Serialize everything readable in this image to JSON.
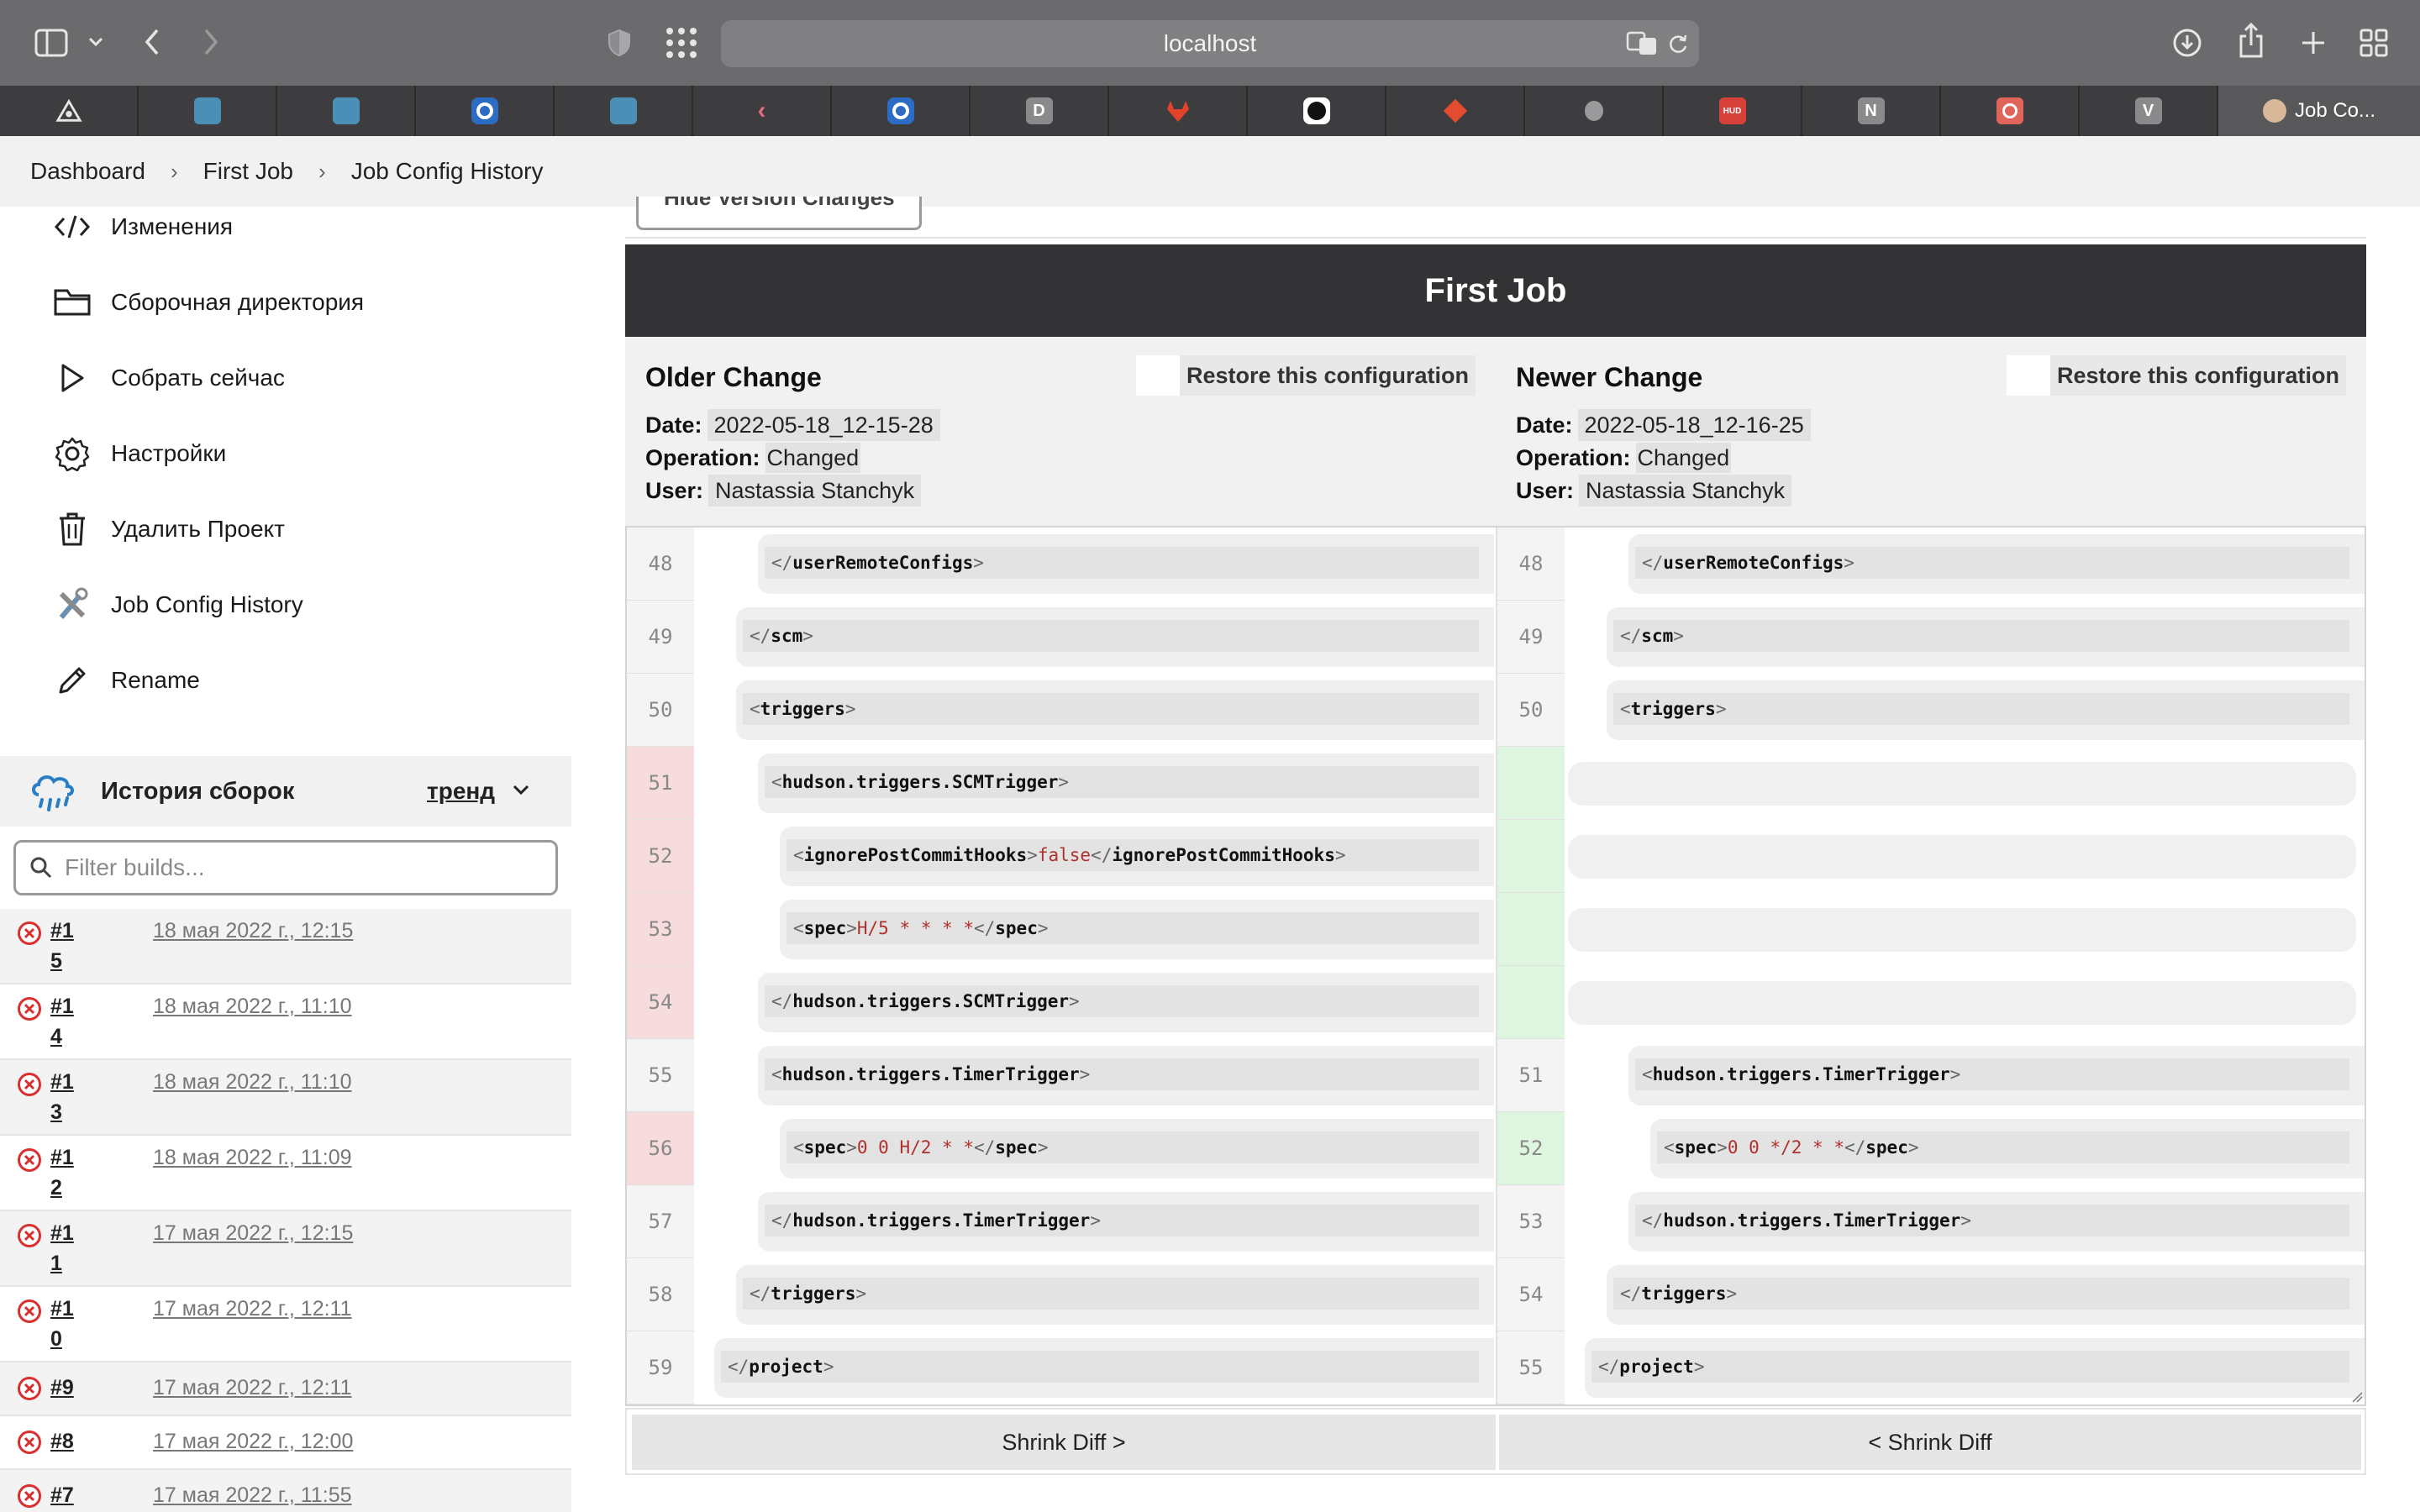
{
  "browser": {
    "url": "localhost",
    "active_tab_label": "Job Co...",
    "tabs": [
      {
        "icon": "app-icon",
        "label": ""
      },
      {
        "icon": "book-icon",
        "label": ""
      },
      {
        "icon": "book-icon",
        "label": ""
      },
      {
        "icon": "circle-icon",
        "label": ""
      },
      {
        "icon": "book-icon",
        "label": ""
      },
      {
        "icon": "flutter-icon",
        "label": ""
      },
      {
        "icon": "circle-icon",
        "label": ""
      },
      {
        "icon": "letter-icon",
        "label": "D"
      },
      {
        "icon": "gitlab-icon",
        "label": ""
      },
      {
        "icon": "github-icon",
        "label": ""
      },
      {
        "icon": "git-icon",
        "label": ""
      },
      {
        "icon": "apple-icon",
        "label": ""
      },
      {
        "icon": "hud-icon",
        "label": "HUD"
      },
      {
        "icon": "letter-icon",
        "label": "N"
      },
      {
        "icon": "openai-icon",
        "label": ""
      },
      {
        "icon": "letter-icon",
        "label": "V"
      }
    ]
  },
  "breadcrumb": [
    "Dashboard",
    "First Job",
    "Job Config History"
  ],
  "sidebar": {
    "tasks": [
      {
        "icon": "code-icon",
        "label": "Изменения"
      },
      {
        "icon": "folder-icon",
        "label": "Сборочная директория"
      },
      {
        "icon": "play-icon",
        "label": "Собрать сейчас"
      },
      {
        "icon": "gear-icon",
        "label": "Настройки"
      },
      {
        "icon": "trash-icon",
        "label": "Удалить Проект"
      },
      {
        "icon": "tools-icon",
        "label": "Job Config History"
      },
      {
        "icon": "pencil-icon",
        "label": "Rename"
      }
    ],
    "history_title": "История сборок",
    "trend_label": "тренд",
    "filter_placeholder": "Filter builds...",
    "builds": [
      {
        "num": "#15",
        "date": "18 мая 2022 г., 12:15"
      },
      {
        "num": "#14",
        "date": "18 мая 2022 г., 11:10"
      },
      {
        "num": "#13",
        "date": "18 мая 2022 г., 11:10"
      },
      {
        "num": "#12",
        "date": "18 мая 2022 г., 11:09"
      },
      {
        "num": "#11",
        "date": "17 мая 2022 г., 12:15"
      },
      {
        "num": "#10",
        "date": "17 мая 2022 г., 12:11"
      },
      {
        "num": "#9",
        "date": "17 мая 2022 г., 12:11"
      },
      {
        "num": "#8",
        "date": "17 мая 2022 г., 12:00"
      },
      {
        "num": "#7",
        "date": "17 мая 2022 г., 11:55"
      }
    ]
  },
  "main": {
    "hide_button_label": "Hide Version Changes",
    "job_title": "First Job",
    "older": {
      "heading": "Older Change",
      "restore_label": "Restore this configuration",
      "date_label": "Date:",
      "date": "2022-05-18_12-15-28",
      "operation_label": "Operation:",
      "operation": "Changed",
      "user_label": "User:",
      "user": "Nastassia Stanchyk"
    },
    "newer": {
      "heading": "Newer Change",
      "restore_label": "Restore this configuration",
      "date_label": "Date:",
      "date": "2022-05-18_12-16-25",
      "operation_label": "Operation:",
      "operation": "Changed",
      "user_label": "User:",
      "user": "Nastassia Stanchyk"
    },
    "diff_left": [
      {
        "n": "48",
        "state": "same",
        "indent": 2,
        "parts": [
          [
            "br",
            "</"
          ],
          [
            "tag",
            "userRemoteConfigs"
          ],
          [
            "br",
            ">"
          ]
        ]
      },
      {
        "n": "49",
        "state": "same",
        "indent": 1,
        "parts": [
          [
            "br",
            "</"
          ],
          [
            "tag",
            "scm"
          ],
          [
            "br",
            ">"
          ]
        ]
      },
      {
        "n": "50",
        "state": "same",
        "indent": 1,
        "parts": [
          [
            "br",
            "<"
          ],
          [
            "tag",
            "triggers"
          ],
          [
            "br",
            ">"
          ]
        ]
      },
      {
        "n": "51",
        "state": "del",
        "indent": 2,
        "parts": [
          [
            "br",
            "<"
          ],
          [
            "tag",
            "hudson.triggers.SCMTrigger"
          ],
          [
            "br",
            ">"
          ]
        ]
      },
      {
        "n": "52",
        "state": "del",
        "indent": 3,
        "parts": [
          [
            "br",
            "<"
          ],
          [
            "tag",
            "ignorePostCommitHooks"
          ],
          [
            "br",
            ">"
          ],
          [
            "txt",
            "false"
          ],
          [
            "br",
            "</"
          ],
          [
            "tag",
            "ignorePostCommitHooks"
          ],
          [
            "br",
            ">"
          ]
        ]
      },
      {
        "n": "53",
        "state": "del",
        "indent": 3,
        "parts": [
          [
            "br",
            "<"
          ],
          [
            "tag",
            "spec"
          ],
          [
            "br",
            ">"
          ],
          [
            "txt",
            "H/5 * * * *"
          ],
          [
            "br",
            "</"
          ],
          [
            "tag",
            "spec"
          ],
          [
            "br",
            ">"
          ]
        ]
      },
      {
        "n": "54",
        "state": "del",
        "indent": 2,
        "parts": [
          [
            "br",
            "</"
          ],
          [
            "tag",
            "hudson.triggers.SCMTrigger"
          ],
          [
            "br",
            ">"
          ]
        ]
      },
      {
        "n": "55",
        "state": "same",
        "indent": 2,
        "parts": [
          [
            "br",
            "<"
          ],
          [
            "tag",
            "hudson.triggers.TimerTrigger"
          ],
          [
            "br",
            ">"
          ]
        ]
      },
      {
        "n": "56",
        "state": "del",
        "indent": 3,
        "parts": [
          [
            "br",
            "<"
          ],
          [
            "tag",
            "spec"
          ],
          [
            "br",
            ">"
          ],
          [
            "txt",
            "0 0 H/2 * *"
          ],
          [
            "br",
            "</"
          ],
          [
            "tag",
            "spec"
          ],
          [
            "br",
            ">"
          ]
        ]
      },
      {
        "n": "57",
        "state": "same",
        "indent": 2,
        "parts": [
          [
            "br",
            "</"
          ],
          [
            "tag",
            "hudson.triggers.TimerTrigger"
          ],
          [
            "br",
            ">"
          ]
        ]
      },
      {
        "n": "58",
        "state": "same",
        "indent": 1,
        "parts": [
          [
            "br",
            "</"
          ],
          [
            "tag",
            "triggers"
          ],
          [
            "br",
            ">"
          ]
        ]
      },
      {
        "n": "59",
        "state": "same",
        "indent": 0,
        "parts": [
          [
            "br",
            "</"
          ],
          [
            "tag",
            "project"
          ],
          [
            "br",
            ">"
          ]
        ]
      }
    ],
    "diff_right": [
      {
        "n": "48",
        "state": "same",
        "indent": 2,
        "parts": [
          [
            "br",
            "</"
          ],
          [
            "tag",
            "userRemoteConfigs"
          ],
          [
            "br",
            ">"
          ]
        ]
      },
      {
        "n": "49",
        "state": "same",
        "indent": 1,
        "parts": [
          [
            "br",
            "</"
          ],
          [
            "tag",
            "scm"
          ],
          [
            "br",
            ">"
          ]
        ]
      },
      {
        "n": "50",
        "state": "same",
        "indent": 1,
        "parts": [
          [
            "br",
            "<"
          ],
          [
            "tag",
            "triggers"
          ],
          [
            "br",
            ">"
          ]
        ]
      },
      {
        "n": "",
        "state": "add-blank",
        "indent": 0,
        "parts": []
      },
      {
        "n": "",
        "state": "add-blank",
        "indent": 0,
        "parts": []
      },
      {
        "n": "",
        "state": "add-blank",
        "indent": 0,
        "parts": []
      },
      {
        "n": "",
        "state": "add-blank",
        "indent": 0,
        "parts": []
      },
      {
        "n": "51",
        "state": "same",
        "indent": 2,
        "parts": [
          [
            "br",
            "<"
          ],
          [
            "tag",
            "hudson.triggers.TimerTrigger"
          ],
          [
            "br",
            ">"
          ]
        ]
      },
      {
        "n": "52",
        "state": "add",
        "indent": 3,
        "parts": [
          [
            "br",
            "<"
          ],
          [
            "tag",
            "spec"
          ],
          [
            "br",
            ">"
          ],
          [
            "txt",
            "0 0 */2 * *"
          ],
          [
            "br",
            "</"
          ],
          [
            "tag",
            "spec"
          ],
          [
            "br",
            ">"
          ]
        ]
      },
      {
        "n": "53",
        "state": "same",
        "indent": 2,
        "parts": [
          [
            "br",
            "</"
          ],
          [
            "tag",
            "hudson.triggers.TimerTrigger"
          ],
          [
            "br",
            ">"
          ]
        ]
      },
      {
        "n": "54",
        "state": "same",
        "indent": 1,
        "parts": [
          [
            "br",
            "</"
          ],
          [
            "tag",
            "triggers"
          ],
          [
            "br",
            ">"
          ]
        ]
      },
      {
        "n": "55",
        "state": "same",
        "indent": 0,
        "parts": [
          [
            "br",
            "</"
          ],
          [
            "tag",
            "project"
          ],
          [
            "br",
            ">"
          ]
        ]
      }
    ],
    "shrink_left_label": "Shrink Diff >",
    "shrink_right_label": "< Shrink Diff"
  }
}
